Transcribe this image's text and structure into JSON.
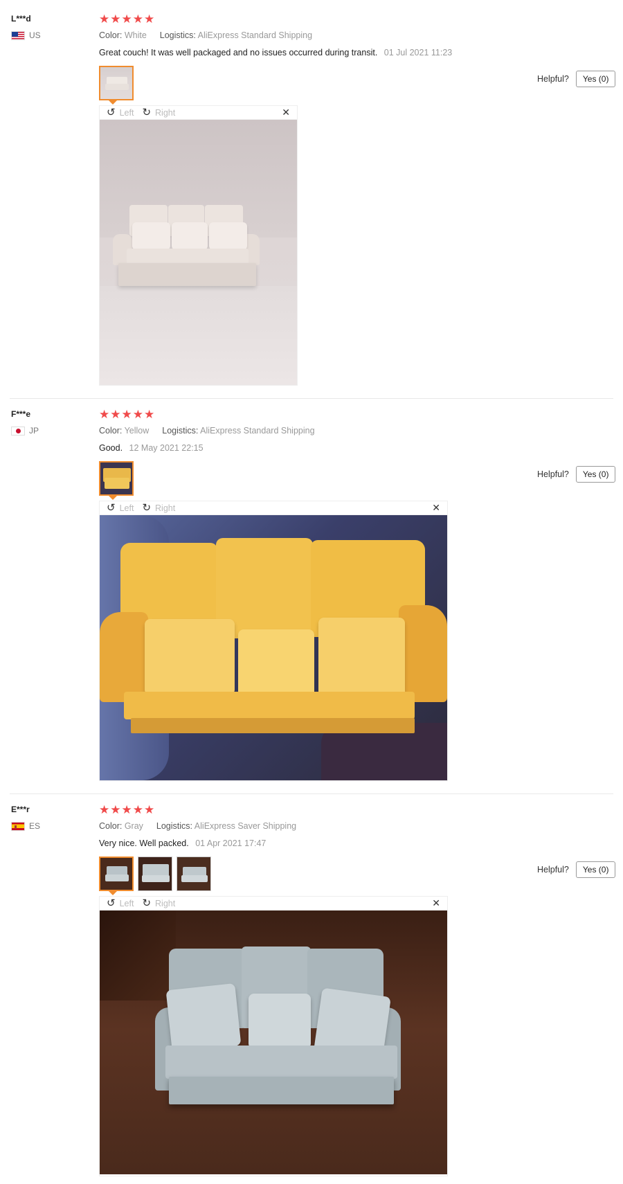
{
  "reviews": [
    {
      "user": "L***d",
      "country": "US",
      "rating": 5,
      "color_label": "Color:",
      "color": "White",
      "logistics_label": "Logistics:",
      "logistics": "AliExpress Standard Shipping",
      "comment": "Great couch! It was well packaged and no issues occurred during transit.",
      "date": "01 Jul 2021 11:23",
      "helpful_label": "Helpful?",
      "yes_label": "Yes (0)",
      "rotate_left": "Left",
      "rotate_right": "Right",
      "photo_count": 1,
      "photo": "white-sofa-photo"
    },
    {
      "user": "F***e",
      "country": "JP",
      "rating": 5,
      "color_label": "Color:",
      "color": "Yellow",
      "logistics_label": "Logistics:",
      "logistics": "AliExpress Standard Shipping",
      "comment": "Good.",
      "date": "12 May 2021 22:15",
      "helpful_label": "Helpful?",
      "yes_label": "Yes (0)",
      "rotate_left": "Left",
      "rotate_right": "Right",
      "photo_count": 1,
      "photo": "yellow-sofa-photo"
    },
    {
      "user": "E***r",
      "country": "ES",
      "rating": 5,
      "color_label": "Color:",
      "color": "Gray",
      "logistics_label": "Logistics:",
      "logistics": "AliExpress Saver Shipping",
      "comment": "Very nice. Well packed.",
      "date": "01 Apr 2021 17:47",
      "helpful_label": "Helpful?",
      "yes_label": "Yes (0)",
      "rotate_left": "Left",
      "rotate_right": "Right",
      "photo_count": 3,
      "photo": "gray-sofa-photo"
    }
  ],
  "icons": {
    "star": "star-icon",
    "rotate_left": "rotate-left-icon",
    "rotate_right": "rotate-right-icon",
    "close": "close-icon"
  },
  "colors": {
    "star": "#f04a4a",
    "thumb_active_border": "#f08c2e",
    "meta_text": "#999999"
  }
}
